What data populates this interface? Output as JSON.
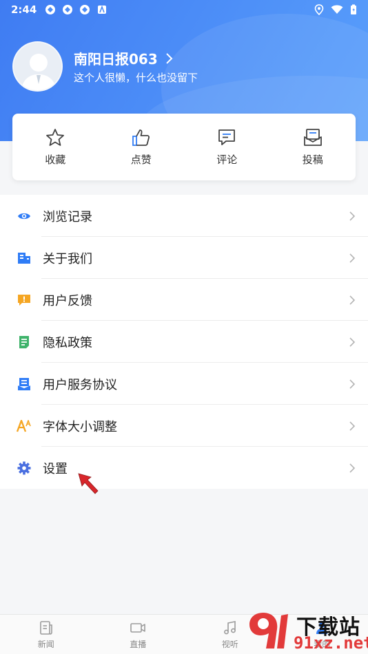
{
  "status_bar": {
    "time": "2:44"
  },
  "profile": {
    "username": "南阳日报063",
    "signature": "这个人很懒，什么也没留下"
  },
  "actions": [
    {
      "label": "收藏",
      "icon": "star-icon"
    },
    {
      "label": "点赞",
      "icon": "thumbs-up-icon"
    },
    {
      "label": "评论",
      "icon": "comment-icon"
    },
    {
      "label": "投稿",
      "icon": "submit-icon"
    }
  ],
  "menu": [
    {
      "label": "浏览记录",
      "icon": "eye-icon",
      "color": "#2f7cf6"
    },
    {
      "label": "关于我们",
      "icon": "building-icon",
      "color": "#2f7cf6"
    },
    {
      "label": "用户反馈",
      "icon": "feedback-icon",
      "color": "#f5a623"
    },
    {
      "label": "隐私政策",
      "icon": "document-icon",
      "color": "#3fb36b"
    },
    {
      "label": "用户服务协议",
      "icon": "agreement-icon",
      "color": "#2f7cf6"
    },
    {
      "label": "字体大小调整",
      "icon": "font-size-icon",
      "color": "#f5a623"
    },
    {
      "label": "设置",
      "icon": "gear-icon",
      "color": "#4a6fe0"
    }
  ],
  "tabbar": [
    {
      "label": "新闻",
      "icon": "news-icon"
    },
    {
      "label": "直播",
      "icon": "video-icon"
    },
    {
      "label": "视听",
      "icon": "music-icon"
    },
    {
      "label": "我的",
      "icon": "profile-icon"
    }
  ],
  "watermark": {
    "cn": "下载站",
    "en": "91xz.net"
  },
  "colors": {
    "header": "#4b8cf7",
    "pointer": "#d8262b",
    "watermark_red": "#e23a3a"
  }
}
